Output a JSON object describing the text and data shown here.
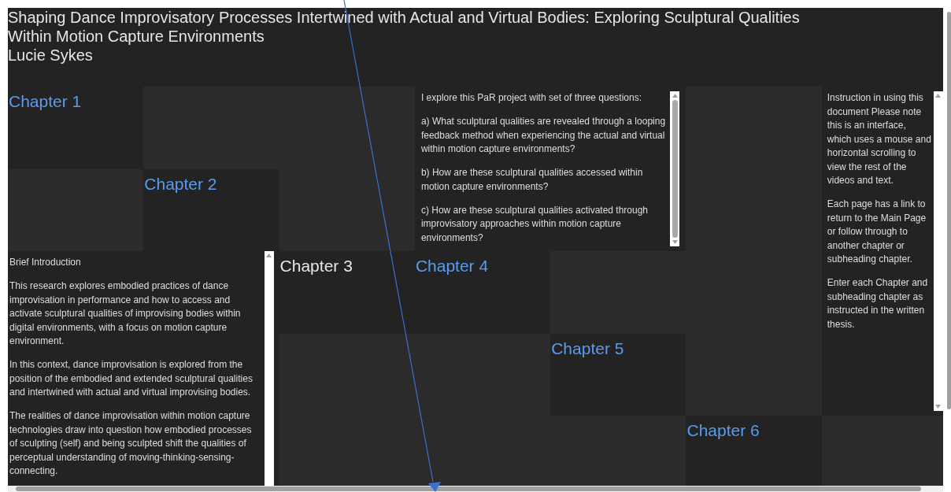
{
  "header": {
    "title": "Shaping Dance Improvisatory Processes Intertwined with Actual and Virtual Bodies: Exploring Sculptural Qualities Within Motion Capture Environments",
    "author": "Lucie Sykes"
  },
  "tiles": [
    {
      "kind": "chapter",
      "label": "Chapter 1",
      "selected": false
    },
    {
      "kind": "text",
      "paragraphs": [
        "I explore this PaR project with set of three questions:",
        "a) What sculptural qualities are revealed through a looping feedback method when experiencing the actual and virtual within motion capture environments?",
        "b) How are these sculptural qualities accessed within motion capture environments?",
        "c) How are these sculptural qualities activated through improvisatory approaches within motion capture environments?"
      ]
    },
    {
      "kind": "text",
      "paragraphs": [
        "Instruction in using this document Please note this is an interface, which uses a mouse and horizontal scrolling to view the rest of the videos and text.",
        "Each page has a link to return to the Main Page or follow through to another chapter or subheading chapter.",
        "Enter each Chapter and subheading chapter as instructed in the written thesis."
      ]
    },
    {
      "kind": "chapter",
      "label": "Chapter 2",
      "selected": false
    },
    {
      "kind": "text",
      "paragraphs": [
        "Brief Introduction",
        "This research explores embodied practices of dance improvisation in performance and how to access and activate sculptural qualities of improvising bodies within digital environments, with a focus on motion capture environment.",
        "In this context, dance improvisation is explored from the position of the embodied and extended sculptural qualities and intertwined with actual and virtual improvising bodies.",
        "The realities of dance improvisation within motion capture technologies draw into question how embodied processes of sculpting (self) and being sculpted shift the qualities of perceptual understanding of moving-thinking-sensing-connecting."
      ]
    },
    {
      "kind": "chapter",
      "label": "Chapter 3",
      "selected": true
    },
    {
      "kind": "chapter",
      "label": "Chapter 4",
      "selected": false
    },
    {
      "kind": "chapter",
      "label": "Chapter 5",
      "selected": false
    },
    {
      "kind": "chapter",
      "label": "Chapter 6",
      "selected": false
    }
  ]
}
